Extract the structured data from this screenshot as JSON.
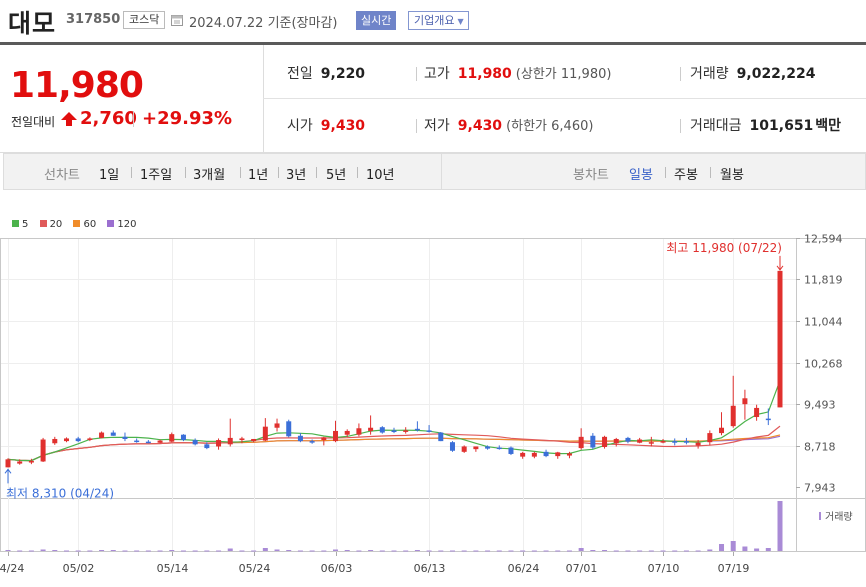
{
  "header": {
    "stock_name": "대모",
    "stock_code": "317850",
    "market": "코스닥",
    "date": "2024.07.22 기준(장마감)",
    "realtime_label": "실시간",
    "corp_info_label": "기업개요"
  },
  "summary": {
    "price": "11,980",
    "change_label": "전일대비",
    "change_value": "2,760",
    "change_rate": "+29.93%",
    "prev_close_label": "전일",
    "prev_close": "9,220",
    "high_label": "고가",
    "high": "11,980",
    "upper_limit": "(상한가 11,980)",
    "volume_label": "거래량",
    "volume": "9,022,224",
    "open_label": "시가",
    "open": "9,430",
    "low_label": "저가",
    "low": "9,430",
    "lower_limit": "(하한가 6,460)",
    "amount_label": "거래대금",
    "amount": "101,651",
    "amount_unit": "백만"
  },
  "tabs": {
    "line_label": "선차트",
    "line_items": [
      "1일",
      "1주일",
      "3개월",
      "1년",
      "3년",
      "5년",
      "10년"
    ],
    "candle_label": "봉차트",
    "candle_items": [
      "일봉",
      "주봉",
      "월봉"
    ],
    "candle_selected": 0
  },
  "colors": {
    "up": "#e0302e",
    "down": "#3b6fd8",
    "ma5": "#4cb34c",
    "ma20": "#e05a5a",
    "ma60": "#f08c2a",
    "ma120": "#9b6fd0",
    "volume": "#a98bd6"
  },
  "chart_data": {
    "type": "candlestick",
    "legend": [
      "5",
      "20",
      "60",
      "120"
    ],
    "y_ticks": [
      "12,594",
      "11,819",
      "11,044",
      "10,268",
      "9,493",
      "8,718",
      "7,943"
    ],
    "y_tick_values": [
      12594,
      11819,
      11044,
      10268,
      9493,
      8718,
      7943
    ],
    "ylim": [
      7943,
      12594
    ],
    "x_labels": [
      "04/24",
      "05/02",
      "05/14",
      "05/24",
      "06/03",
      "06/13",
      "06/24",
      "07/01",
      "07/10",
      "07/19"
    ],
    "x_label_index": [
      0,
      6,
      14,
      21,
      28,
      36,
      44,
      49,
      56,
      62
    ],
    "high_annotation": "최고 11,980 (07/22)",
    "low_annotation": "최저 8,310 (04/24)",
    "volume_label": "거래량",
    "candles": [
      {
        "o": 8310,
        "h": 8480,
        "l": 8310,
        "c": 8460
      },
      {
        "o": 8380,
        "h": 8460,
        "l": 8360,
        "c": 8420
      },
      {
        "o": 8400,
        "h": 8470,
        "l": 8370,
        "c": 8430
      },
      {
        "o": 8420,
        "h": 8860,
        "l": 8410,
        "c": 8830
      },
      {
        "o": 8760,
        "h": 8880,
        "l": 8730,
        "c": 8840
      },
      {
        "o": 8800,
        "h": 8870,
        "l": 8780,
        "c": 8850
      },
      {
        "o": 8850,
        "h": 8880,
        "l": 8780,
        "c": 8800
      },
      {
        "o": 8830,
        "h": 8870,
        "l": 8800,
        "c": 8850
      },
      {
        "o": 8860,
        "h": 8980,
        "l": 8850,
        "c": 8960
      },
      {
        "o": 8960,
        "h": 9000,
        "l": 8900,
        "c": 8900
      },
      {
        "o": 8880,
        "h": 8960,
        "l": 8800,
        "c": 8840
      },
      {
        "o": 8810,
        "h": 8850,
        "l": 8770,
        "c": 8800
      },
      {
        "o": 8790,
        "h": 8820,
        "l": 8760,
        "c": 8780
      },
      {
        "o": 8770,
        "h": 8830,
        "l": 8760,
        "c": 8810
      },
      {
        "o": 8790,
        "h": 8960,
        "l": 8780,
        "c": 8930
      },
      {
        "o": 8920,
        "h": 8930,
        "l": 8800,
        "c": 8820
      },
      {
        "o": 8820,
        "h": 8850,
        "l": 8720,
        "c": 8740
      },
      {
        "o": 8740,
        "h": 8780,
        "l": 8650,
        "c": 8670
      },
      {
        "o": 8700,
        "h": 8850,
        "l": 8640,
        "c": 8820
      },
      {
        "o": 8740,
        "h": 9220,
        "l": 8700,
        "c": 8860
      },
      {
        "o": 8820,
        "h": 8880,
        "l": 8760,
        "c": 8850
      },
      {
        "o": 8800,
        "h": 8840,
        "l": 8780,
        "c": 8840
      },
      {
        "o": 8810,
        "h": 9230,
        "l": 8800,
        "c": 9070
      },
      {
        "o": 9050,
        "h": 9220,
        "l": 8980,
        "c": 9130
      },
      {
        "o": 9170,
        "h": 9200,
        "l": 8870,
        "c": 8890
      },
      {
        "o": 8900,
        "h": 8950,
        "l": 8780,
        "c": 8800
      },
      {
        "o": 8800,
        "h": 8830,
        "l": 8750,
        "c": 8790
      },
      {
        "o": 8820,
        "h": 8880,
        "l": 8720,
        "c": 8870
      },
      {
        "o": 8800,
        "h": 9180,
        "l": 8780,
        "c": 8990
      },
      {
        "o": 8920,
        "h": 9020,
        "l": 8880,
        "c": 8990
      },
      {
        "o": 8920,
        "h": 9130,
        "l": 8890,
        "c": 9040
      },
      {
        "o": 8990,
        "h": 9280,
        "l": 8920,
        "c": 9050
      },
      {
        "o": 9060,
        "h": 9080,
        "l": 8940,
        "c": 8960
      },
      {
        "o": 9000,
        "h": 9050,
        "l": 8950,
        "c": 8970
      },
      {
        "o": 8980,
        "h": 9060,
        "l": 8940,
        "c": 9000
      },
      {
        "o": 9030,
        "h": 9170,
        "l": 8980,
        "c": 9020
      },
      {
        "o": 9000,
        "h": 9100,
        "l": 8960,
        "c": 8980
      },
      {
        "o": 8960,
        "h": 8970,
        "l": 8800,
        "c": 8800
      },
      {
        "o": 8780,
        "h": 8800,
        "l": 8600,
        "c": 8620
      },
      {
        "o": 8600,
        "h": 8720,
        "l": 8580,
        "c": 8700
      },
      {
        "o": 8650,
        "h": 8700,
        "l": 8600,
        "c": 8700
      },
      {
        "o": 8700,
        "h": 8720,
        "l": 8640,
        "c": 8660
      },
      {
        "o": 8680,
        "h": 8720,
        "l": 8640,
        "c": 8660
      },
      {
        "o": 8680,
        "h": 8700,
        "l": 8540,
        "c": 8560
      },
      {
        "o": 8510,
        "h": 8600,
        "l": 8470,
        "c": 8580
      },
      {
        "o": 8510,
        "h": 8600,
        "l": 8480,
        "c": 8580
      },
      {
        "o": 8600,
        "h": 8640,
        "l": 8500,
        "c": 8520
      },
      {
        "o": 8520,
        "h": 8600,
        "l": 8470,
        "c": 8590
      },
      {
        "o": 8530,
        "h": 8600,
        "l": 8480,
        "c": 8570
      },
      {
        "o": 8670,
        "h": 9040,
        "l": 8640,
        "c": 8880
      },
      {
        "o": 8900,
        "h": 8950,
        "l": 8650,
        "c": 8680
      },
      {
        "o": 8690,
        "h": 8900,
        "l": 8660,
        "c": 8880
      },
      {
        "o": 8760,
        "h": 8860,
        "l": 8700,
        "c": 8840
      },
      {
        "o": 8860,
        "h": 8880,
        "l": 8760,
        "c": 8790
      },
      {
        "o": 8770,
        "h": 8860,
        "l": 8760,
        "c": 8830
      },
      {
        "o": 8770,
        "h": 8880,
        "l": 8700,
        "c": 8780
      },
      {
        "o": 8780,
        "h": 8840,
        "l": 8760,
        "c": 8800
      },
      {
        "o": 8800,
        "h": 8850,
        "l": 8720,
        "c": 8770
      },
      {
        "o": 8800,
        "h": 8860,
        "l": 8740,
        "c": 8770
      },
      {
        "o": 8720,
        "h": 8820,
        "l": 8660,
        "c": 8770
      },
      {
        "o": 8780,
        "h": 9000,
        "l": 8720,
        "c": 8950
      },
      {
        "o": 8950,
        "h": 9340,
        "l": 8910,
        "c": 9050
      },
      {
        "o": 9080,
        "h": 10020,
        "l": 9050,
        "c": 9460
      },
      {
        "o": 9490,
        "h": 9760,
        "l": 9200,
        "c": 9600
      },
      {
        "o": 9250,
        "h": 9480,
        "l": 9180,
        "c": 9420
      },
      {
        "o": 9220,
        "h": 9410,
        "l": 9100,
        "c": 9200
      },
      {
        "o": 9430,
        "h": 11980,
        "l": 9430,
        "c": 11980
      }
    ],
    "volumes": [
      2,
      1,
      1,
      3,
      2,
      1,
      1,
      1,
      2,
      2,
      1,
      1,
      1,
      1,
      2,
      1,
      1,
      1,
      1,
      5,
      1,
      1,
      6,
      3,
      2,
      1,
      1,
      1,
      3,
      2,
      1,
      2,
      1,
      1,
      1,
      2,
      1,
      1,
      1,
      1,
      1,
      1,
      1,
      1,
      1,
      1,
      1,
      1,
      1,
      6,
      2,
      2,
      1,
      1,
      1,
      1,
      1,
      1,
      1,
      1,
      3,
      14,
      20,
      9,
      5,
      6,
      100
    ]
  }
}
